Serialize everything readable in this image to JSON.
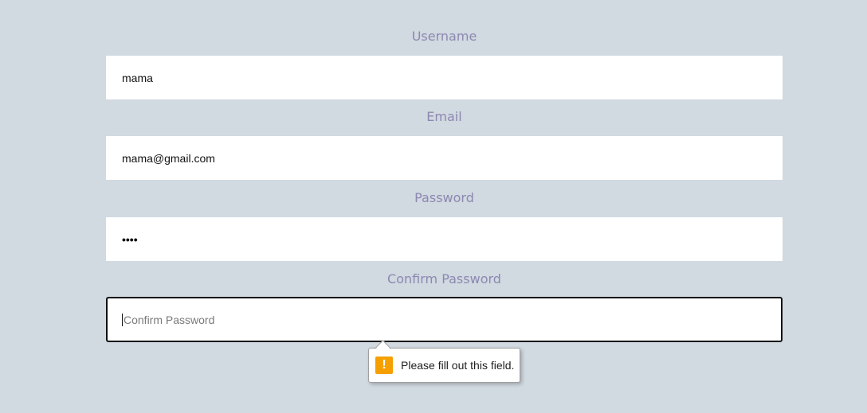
{
  "form": {
    "username": {
      "label": "Username",
      "value": "mama"
    },
    "email": {
      "label": "Email",
      "value": "mama@gmail.com"
    },
    "password": {
      "label": "Password",
      "value": "••••"
    },
    "confirm_password": {
      "label": "Confirm Password",
      "placeholder": "Confirm Password",
      "value": ""
    }
  },
  "validation_tooltip": {
    "icon": "warning-icon",
    "icon_glyph": "!",
    "message": "Please fill out this field.",
    "icon_color": "#f5a000"
  },
  "colors": {
    "background": "#d1d9e1",
    "label": "#8d88b0",
    "field": "#ffffff"
  }
}
